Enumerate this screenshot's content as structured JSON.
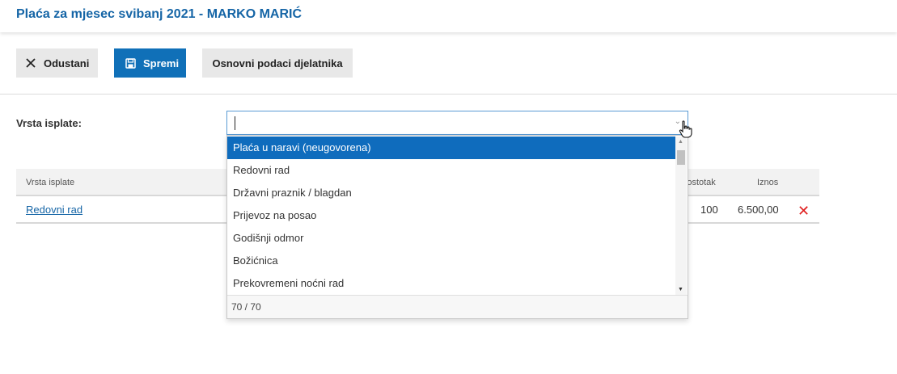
{
  "header": {
    "title": "Plaća za mjesec svibanj 2021 - MARKO MARIĆ"
  },
  "toolbar": {
    "cancel_label": "Odustani",
    "save_label": "Spremi",
    "basic_data_label": "Osnovni podaci djelatnika",
    "cancel_icon": "close-icon",
    "save_icon": "save-icon"
  },
  "form": {
    "payment_type_label": "Vrsta isplate:",
    "payment_type_value": ""
  },
  "table": {
    "columns": {
      "type": "Vrsta isplate",
      "percent": "Postotak",
      "amount": "Iznos"
    },
    "rows": [
      {
        "type": "Redovni rad",
        "percent": "100",
        "amount": "6.500,00"
      }
    ]
  },
  "dropdown": {
    "options": [
      "Plaća u naravi (neugovorena)",
      "Redovni rad",
      "Državni praznik / blagdan",
      "Prijevoz na posao",
      "Godišnji odmor",
      "Božićnica",
      "Prekovremeni noćni rad"
    ],
    "selected_index": 0,
    "count_text": "70 / 70"
  },
  "colors": {
    "accent": "#1070b8",
    "title": "#1565a6",
    "delete": "#e02020"
  }
}
